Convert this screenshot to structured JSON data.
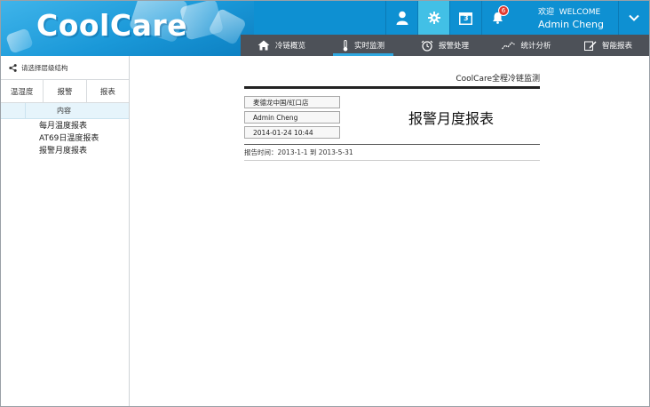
{
  "brand": {
    "logo": "CoolCare"
  },
  "header": {
    "notification_count": "6",
    "calendar_day": "3",
    "welcome_prefix": "欢迎",
    "welcome_word": "WELCOME",
    "user_name": "Admin Cheng"
  },
  "nav": {
    "items": [
      {
        "label": "冷链概览",
        "icon": "home-icon"
      },
      {
        "label": "实时监测",
        "icon": "thermometer-icon"
      },
      {
        "label": "报警处理",
        "icon": "alarm-clock-icon"
      },
      {
        "label": "统计分析",
        "icon": "trend-chart-icon"
      },
      {
        "label": "智能报表",
        "icon": "report-pen-icon"
      }
    ]
  },
  "sidebar": {
    "title": "请选择层级结构",
    "tabs": [
      "温湿度",
      "报警",
      "报表"
    ],
    "column_header": "内容",
    "reports": [
      "每月温度报表",
      "AT69日温度报表",
      "报警月度报表"
    ]
  },
  "report": {
    "header_title": "CoolCare全程冷链监测",
    "store": "麦德龙中国/虹口店",
    "user": "Admin Cheng",
    "datetime": "2014-01-24 10:44",
    "title": "报警月度报表",
    "period": "报告时间：2013-1-1 到 2013-5-31"
  },
  "colors": {
    "header_blue": "#0e90d2",
    "active_tile": "#42c0e6",
    "nav_bar": "#4d5158",
    "badge_red": "#e23a2f"
  }
}
